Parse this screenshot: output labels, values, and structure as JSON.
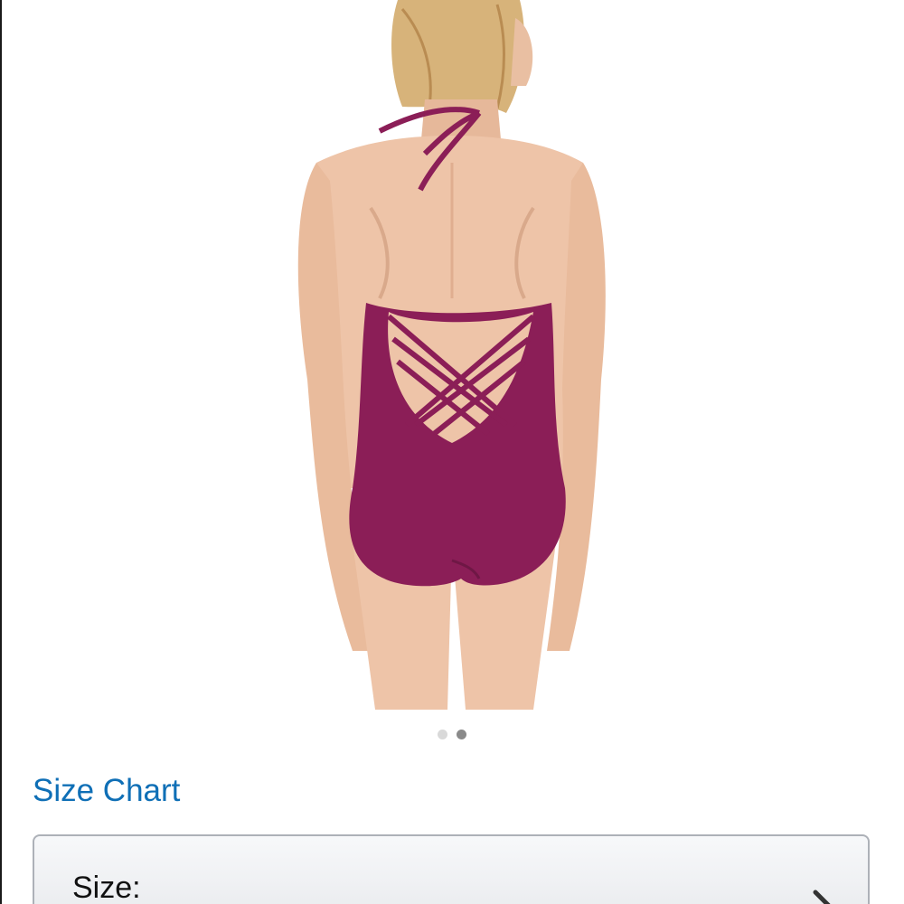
{
  "carousel": {
    "image_alt": "Plum halter one-piece swimsuit with lattice strap back, rear view",
    "dot_count": 2,
    "active_index": 1
  },
  "size_chart": {
    "label": "Size Chart"
  },
  "size_selector": {
    "label": "Size:",
    "icon": "chevron-right-icon"
  },
  "colors": {
    "link": "#0f6fb6",
    "swimsuit": "#8b1e57",
    "dot_inactive": "#d9d9d9",
    "dot_active": "#8a8a8a"
  }
}
